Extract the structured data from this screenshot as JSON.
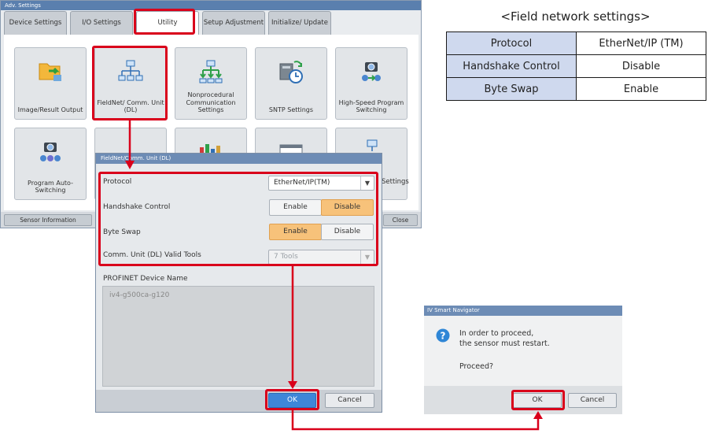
{
  "adv_window": {
    "title": "Adv. Settings",
    "tabs": [
      {
        "label": "Device Settings"
      },
      {
        "label": "I/O Settings"
      },
      {
        "label": "Utility"
      },
      {
        "label": "Setup Adjustment"
      },
      {
        "label": "Initialize/ Update"
      }
    ],
    "tiles": [
      {
        "label": "Image/Result Output",
        "icon": "folder-transfer-icon"
      },
      {
        "label": "FieldNet/ Comm. Unit (DL)",
        "icon": "network-tree-icon"
      },
      {
        "label": "Nonprocedural Communication Settings",
        "icon": "network-arrows-icon"
      },
      {
        "label": "SNTP Settings",
        "icon": "clock-sync-icon"
      },
      {
        "label": "High-Speed Program Switching",
        "icon": "camera-gears-icon"
      },
      {
        "label": "Program Auto-Switching",
        "icon": "camera-auto-icon"
      },
      {
        "label": "Settings",
        "icon": "settings-icon"
      }
    ],
    "footer": {
      "left_label": "Sensor Information",
      "right_label": "Close"
    }
  },
  "fieldnet_dialog": {
    "title": "FieldNet/Comm. Unit (DL)",
    "protocol_label": "Protocol",
    "protocol_value": "EtherNet/IP(TM)",
    "handshake_label": "Handshake Control",
    "byteswap_label": "Byte Swap",
    "enable_label": "Enable",
    "disable_label": "Disable",
    "valid_tools_label": "Comm. Unit (DL) Valid Tools",
    "valid_tools_value": "7 Tools",
    "handshake_selected": "Disable",
    "byteswap_selected": "Enable",
    "profinet_label": "PROFINET Device Name",
    "profinet_placeholder": "iv4-g500ca-g120",
    "ok_label": "OK",
    "cancel_label": "Cancel"
  },
  "navigator_dialog": {
    "title": "IV Smart Navigator",
    "message_line1": "In order to proceed,",
    "message_line2": "the sensor must restart.",
    "question": "Proceed?",
    "ok_label": "OK",
    "cancel_label": "Cancel"
  },
  "network_table": {
    "caption": "<Field network settings>",
    "rows": [
      {
        "key": "Protocol",
        "value": "EtherNet/IP (TM)"
      },
      {
        "key": "Handshake Control",
        "value": "Disable"
      },
      {
        "key": "Byte Swap",
        "value": "Enable"
      }
    ]
  },
  "colors": {
    "highlight": "#d9001b",
    "selected_segment": "#f7c27a",
    "primary_button": "#3e86d8"
  }
}
